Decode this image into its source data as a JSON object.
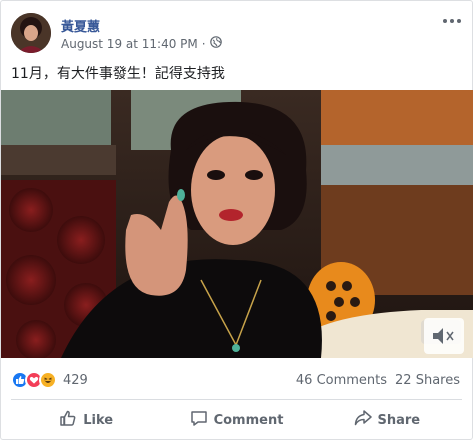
{
  "post": {
    "author": "黃夏蕙",
    "timestamp": "August 19 at 11:40 PM",
    "separator": "·",
    "privacy_icon": "globe-icon",
    "text": "11月，有大件事發生！記得支持我"
  },
  "engagement": {
    "reaction_icons": [
      "like-icon",
      "love-icon",
      "haha-icon"
    ],
    "reaction_count": "429",
    "comments": "46 Comments",
    "shares": "22 Shares"
  },
  "actions": {
    "like": "Like",
    "comment": "Comment",
    "share": "Share"
  },
  "colors": {
    "name_link": "#385898",
    "secondary_text": "#606770",
    "like_blue": "#1877f2",
    "love_red": "#f33e58",
    "haha_yellow": "#f7b125"
  }
}
